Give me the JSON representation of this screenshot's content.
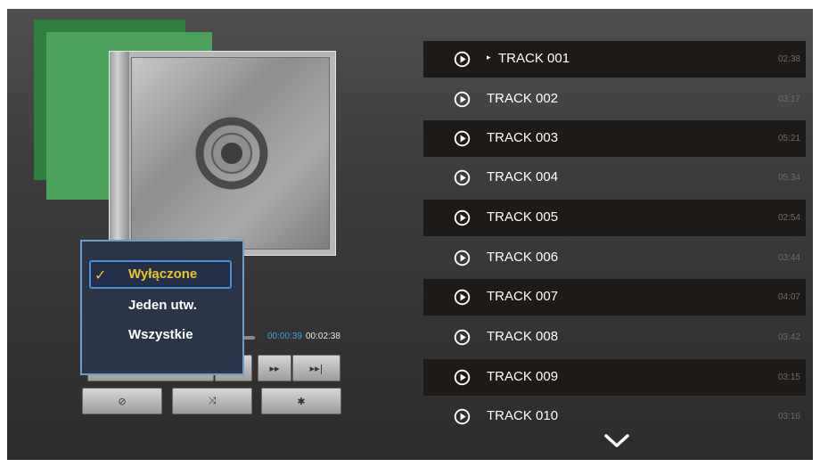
{
  "player": {
    "time_current": "00:00:39",
    "time_total": "00:02:38"
  },
  "controls": {
    "row1": [
      {
        "name": "fast-forward-button",
        "icon": "fast-forward-icon",
        "glyph": "▸▸"
      },
      {
        "name": "skip-next-button",
        "icon": "skip-next-icon",
        "glyph": "▸▸|"
      }
    ],
    "row2": [
      {
        "name": "repeat-off-button",
        "icon": "repeat-off-icon",
        "glyph": "⊘"
      },
      {
        "name": "shuffle-off-button",
        "icon": "shuffle-off-icon",
        "glyph": "⤨"
      },
      {
        "name": "settings-button",
        "icon": "gear-icon",
        "glyph": "✱"
      }
    ]
  },
  "repeat_menu": {
    "options": [
      "Wyłączone",
      "Jeden utw.",
      "Wszystkie"
    ],
    "selected_index": 0,
    "check_glyph": "✓",
    "selected_color": "#e8c331"
  },
  "tracks": [
    {
      "title": "TRACK 001",
      "duration": "02:38",
      "current": true
    },
    {
      "title": "TRACK 002",
      "duration": "03:17"
    },
    {
      "title": "TRACK 003",
      "duration": "05:21"
    },
    {
      "title": "TRACK 004",
      "duration": "05:34"
    },
    {
      "title": "TRACK 005",
      "duration": "02:54"
    },
    {
      "title": "TRACK 006",
      "duration": "03:44"
    },
    {
      "title": "TRACK 007",
      "duration": "04:07"
    },
    {
      "title": "TRACK 008",
      "duration": "03:42"
    },
    {
      "title": "TRACK 009",
      "duration": "03:15"
    },
    {
      "title": "TRACK 010",
      "duration": "03:16"
    }
  ],
  "now_playing_marker": "▸",
  "icons": {
    "track_play": "play-circle-icon",
    "scroll_down": "chevron-down-icon"
  }
}
